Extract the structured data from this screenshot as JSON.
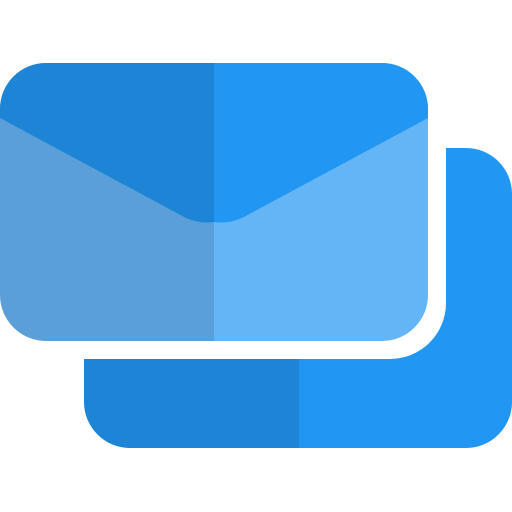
{
  "icon": {
    "name": "stacked-mail-icon",
    "description_role": "icon",
    "colors": {
      "envelope_top_left": "#1E84D6",
      "envelope_top_right": "#2196F3",
      "envelope_body_left": "#5A9FD8",
      "envelope_body_right": "#64B5F6",
      "back_card_left": "#1E84D6",
      "back_card_right": "#2196F3",
      "background": "#FFFFFF"
    }
  }
}
